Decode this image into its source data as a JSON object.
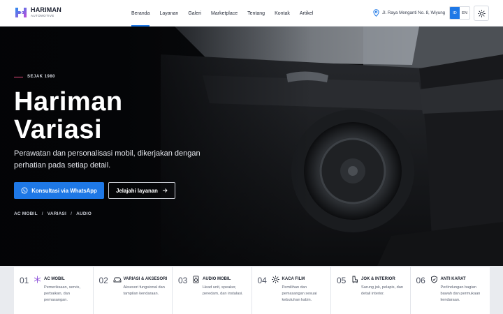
{
  "brand": {
    "name": "HARIMAN",
    "subtitle": "AUTOMOTIVE",
    "accent": "#1e78e6"
  },
  "nav": {
    "items": [
      {
        "label": "Beranda",
        "active": true
      },
      {
        "label": "Layanan",
        "active": false
      },
      {
        "label": "Galeri",
        "active": false
      },
      {
        "label": "Marketplace",
        "active": false
      },
      {
        "label": "Tentang",
        "active": false
      },
      {
        "label": "Kontak",
        "active": false
      },
      {
        "label": "Artikel",
        "active": false
      }
    ],
    "address": "Jl. Raya Menganti No. 8, Wiyung",
    "lang": {
      "id": "ID",
      "en": "EN",
      "selected": "ID"
    },
    "theme_icon": "sun-icon"
  },
  "hero": {
    "since": "SEJAK 1980",
    "title_line1": "Hariman",
    "title_line2": "Variasi",
    "description": "Perawatan dan personalisasi mobil, dikerjakan dengan perhatian pada setiap detail.",
    "primary_button": "Konsultasi via WhatsApp",
    "secondary_button": "Jelajahi layanan",
    "tags": [
      "AC MOBIL",
      "VARIASI",
      "AUDIO"
    ],
    "tag_separator": "/"
  },
  "services": [
    {
      "num": "01",
      "icon": "snowflake-icon",
      "title": "AC MOBIL",
      "desc": "Pemeriksaan, servis, perbaikan, dan pemasangan."
    },
    {
      "num": "02",
      "icon": "car-icon",
      "title": "VARIASI & AKSESORI",
      "desc": "Aksesori fungsional dan tampilan kendaraan."
    },
    {
      "num": "03",
      "icon": "speaker-icon",
      "title": "AUDIO MOBIL",
      "desc": "Head unit, speaker, peredam, dan instalasi."
    },
    {
      "num": "04",
      "icon": "sun-icon",
      "title": "KACA FILM",
      "desc": "Pemilihan dan pemasangan sesuai kebutuhan kabin."
    },
    {
      "num": "05",
      "icon": "seat-icon",
      "title": "JOK & INTERIOR",
      "desc": "Sarung jok, pelapis, dan detail interior."
    },
    {
      "num": "06",
      "icon": "shield-icon",
      "title": "ANTI KARAT",
      "desc": "Perlindungan bagian bawah dan permukaan kendaraan."
    }
  ]
}
